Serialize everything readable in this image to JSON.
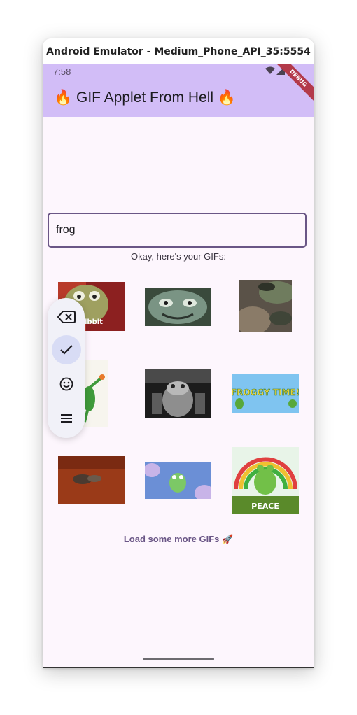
{
  "window": {
    "title": "Android Emulator - Medium_Phone_API_35:5554"
  },
  "status_bar": {
    "time": "7:58",
    "debug_label": "DEBUG"
  },
  "app_bar": {
    "title": "🔥 GIF Applet From Hell 🔥"
  },
  "search": {
    "value": "frog"
  },
  "results": {
    "heading": "Okay, here's your GIFs:",
    "tile1_caption": "ibbit",
    "tile6_caption": "FROGGY TIME!",
    "tile9_caption": "PEACE"
  },
  "load_more": {
    "label": "Load some more GIFs 🚀"
  },
  "floating_toolbar": {
    "items": [
      "backspace-icon",
      "check-icon",
      "emoji-icon",
      "menu-icon"
    ]
  },
  "colors": {
    "app_bar": "#d2bdf7",
    "background": "#fdf6fd",
    "accent": "#6a5686"
  }
}
